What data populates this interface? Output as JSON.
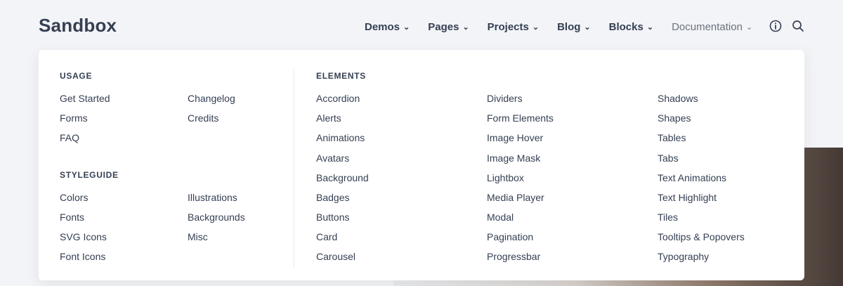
{
  "header": {
    "logo": "Sandbox",
    "nav": [
      {
        "label": "Demos"
      },
      {
        "label": "Pages"
      },
      {
        "label": "Projects"
      },
      {
        "label": "Blog"
      },
      {
        "label": "Blocks"
      },
      {
        "label": "Documentation"
      }
    ],
    "icons": [
      "info-icon",
      "search-icon"
    ]
  },
  "dropdown": {
    "usage": {
      "title": "Usage",
      "col1": [
        "Get Started",
        "Forms",
        "FAQ"
      ],
      "col2": [
        "Changelog",
        "Credits"
      ]
    },
    "styleguide": {
      "title": "Styleguide",
      "col1": [
        "Colors",
        "Fonts",
        "SVG Icons",
        "Font Icons"
      ],
      "col2": [
        "Illustrations",
        "Backgrounds",
        "Misc"
      ]
    },
    "elements": {
      "title": "Elements",
      "col1": [
        "Accordion",
        "Alerts",
        "Animations",
        "Avatars",
        "Background",
        "Badges",
        "Buttons",
        "Card",
        "Carousel"
      ],
      "col2": [
        "Dividers",
        "Form Elements",
        "Image Hover",
        "Image Mask",
        "Lightbox",
        "Media Player",
        "Modal",
        "Pagination",
        "Progressbar"
      ],
      "col3": [
        "Shadows",
        "Shapes",
        "Tables",
        "Tabs",
        "Text Animations",
        "Text Highlight",
        "Tiles",
        "Tooltips & Popovers",
        "Typography"
      ]
    }
  }
}
